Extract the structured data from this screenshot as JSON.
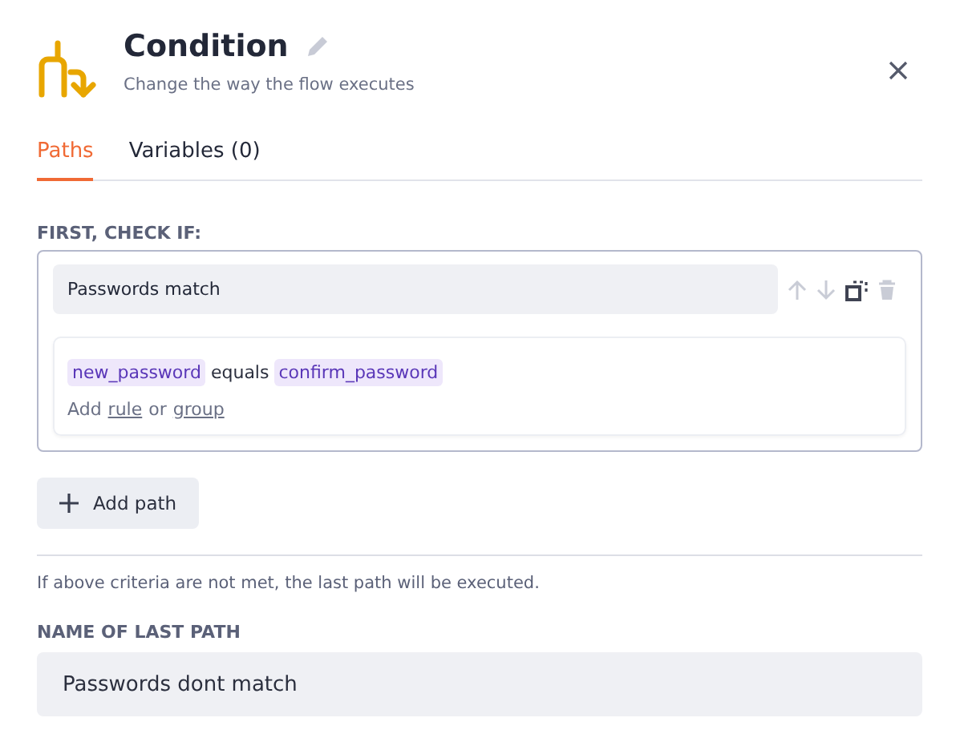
{
  "header": {
    "title": "Condition",
    "subtitle": "Change the way the flow executes"
  },
  "tabs": [
    {
      "label": "Paths",
      "selected": true
    },
    {
      "label": "Variables (0)",
      "selected": false
    }
  ],
  "paths_label": "FIRST, CHECK IF:",
  "paths": [
    {
      "name": "Passwords match",
      "actions": [
        {
          "kind": "up",
          "disabled": true
        },
        {
          "kind": "down",
          "disabled": true
        },
        {
          "kind": "duplicate",
          "disabled": false
        },
        {
          "kind": "delete",
          "disabled": true
        }
      ],
      "rule": {
        "left": "new_password",
        "operator": "equals",
        "right": "confirm_password"
      },
      "add_links": {
        "prefix": "Add",
        "rule": "rule",
        "joiner": "or",
        "group": "group"
      }
    }
  ],
  "add_path_button": "Add path",
  "note": "If above criteria are not met, the last path will be executed.",
  "last_path": {
    "label": "NAME OF LAST PATH",
    "value": "Passwords dont match"
  }
}
